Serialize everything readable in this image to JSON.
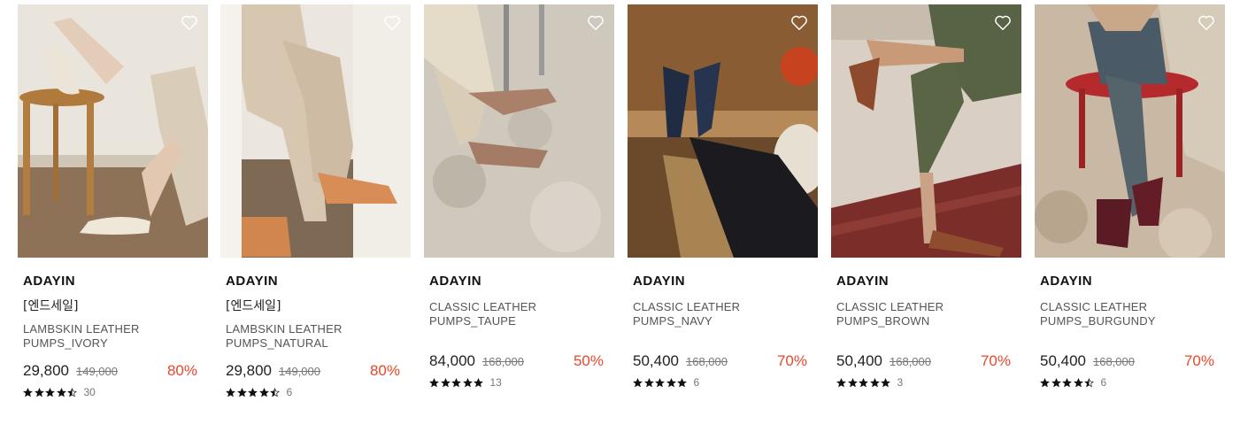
{
  "products": [
    {
      "brand": "ADAYIN",
      "tag": "[엔드세일]",
      "name_line1": "LAMBSKIN LEATHER",
      "name_line2": "PUMPS_IVORY",
      "price": "29,800",
      "original_price": "149,000",
      "discount": "80%",
      "rating": 4.5,
      "review_count": "30",
      "wishlist_icon": "heart-outline-icon",
      "image_theme": "ivory-flats-wooden-stool"
    },
    {
      "brand": "ADAYIN",
      "tag": "[엔드세일]",
      "name_line1": "LAMBSKIN LEATHER",
      "name_line2": "PUMPS_NATURAL",
      "price": "29,800",
      "original_price": "149,000",
      "discount": "80%",
      "rating": 4.5,
      "review_count": "6",
      "wishlist_icon": "heart-outline-icon",
      "image_theme": "natural-low-heels-knit-pants"
    },
    {
      "brand": "ADAYIN",
      "tag": "",
      "name_line1": "CLASSIC LEATHER",
      "name_line2": "PUMPS_TAUPE",
      "price": "84,000",
      "original_price": "168,000",
      "discount": "50%",
      "rating": 5,
      "review_count": "13",
      "wishlist_icon": "heart-outline-icon",
      "image_theme": "taupe-pumps-terrazzo-floor"
    },
    {
      "brand": "ADAYIN",
      "tag": "",
      "name_line1": "CLASSIC LEATHER",
      "name_line2": "PUMPS_NAVY",
      "price": "50,400",
      "original_price": "168,000",
      "discount": "70%",
      "rating": 5,
      "review_count": "6",
      "wishlist_icon": "heart-outline-icon",
      "image_theme": "navy-pumps-cafe"
    },
    {
      "brand": "ADAYIN",
      "tag": "",
      "name_line1": "CLASSIC LEATHER",
      "name_line2": "PUMPS_BROWN",
      "price": "50,400",
      "original_price": "168,000",
      "discount": "70%",
      "rating": 5,
      "review_count": "3",
      "wishlist_icon": "heart-outline-icon",
      "image_theme": "brown-pumps-red-carpet"
    },
    {
      "brand": "ADAYIN",
      "tag": "",
      "name_line1": "CLASSIC LEATHER",
      "name_line2": "PUMPS_BURGUNDY",
      "price": "50,400",
      "original_price": "168,000",
      "discount": "70%",
      "rating": 4.5,
      "review_count": "6",
      "wishlist_icon": "heart-outline-icon",
      "image_theme": "burgundy-pumps-red-stool"
    }
  ],
  "colors": {
    "discount": "#e8472b",
    "star": "#111111",
    "text": "#222222"
  }
}
